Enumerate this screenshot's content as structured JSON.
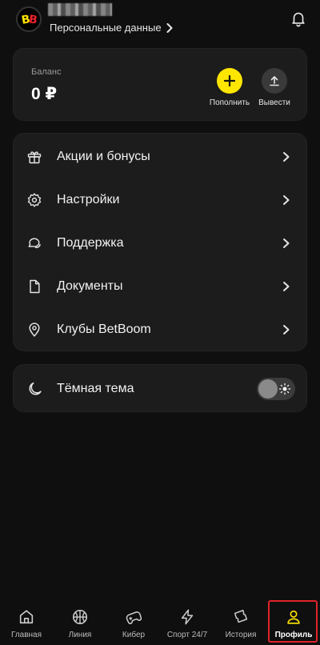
{
  "header": {
    "personal_data_label": "Персональные данные",
    "logo_text": "BB"
  },
  "balance": {
    "label": "Баланс",
    "value": "0 ₽",
    "deposit_label": "Пополнить",
    "withdraw_label": "Вывести"
  },
  "menu": {
    "items": [
      {
        "label": "Акции и бонусы",
        "icon": "gift-icon"
      },
      {
        "label": "Настройки",
        "icon": "gear-icon"
      },
      {
        "label": "Поддержка",
        "icon": "chat-icon"
      },
      {
        "label": "Документы",
        "icon": "document-icon"
      },
      {
        "label": "Клубы BetBoom",
        "icon": "location-pin-icon"
      }
    ]
  },
  "theme": {
    "label": "Тёмная тема",
    "icon": "moon-icon",
    "enabled": false
  },
  "bottom_nav": {
    "items": [
      {
        "label": "Главная",
        "icon": "home-icon"
      },
      {
        "label": "Линия",
        "icon": "basketball-icon"
      },
      {
        "label": "Кибер",
        "icon": "gamepad-icon"
      },
      {
        "label": "Спорт 24/7",
        "icon": "lightning-icon"
      },
      {
        "label": "История",
        "icon": "ticket-icon"
      },
      {
        "label": "Профиль",
        "icon": "user-icon"
      }
    ],
    "active": "Профиль"
  },
  "colors": {
    "accent": "#ffe600",
    "highlight_frame": "#e0242a",
    "background": "#0f0f0f",
    "card": "#1c1c1c"
  }
}
